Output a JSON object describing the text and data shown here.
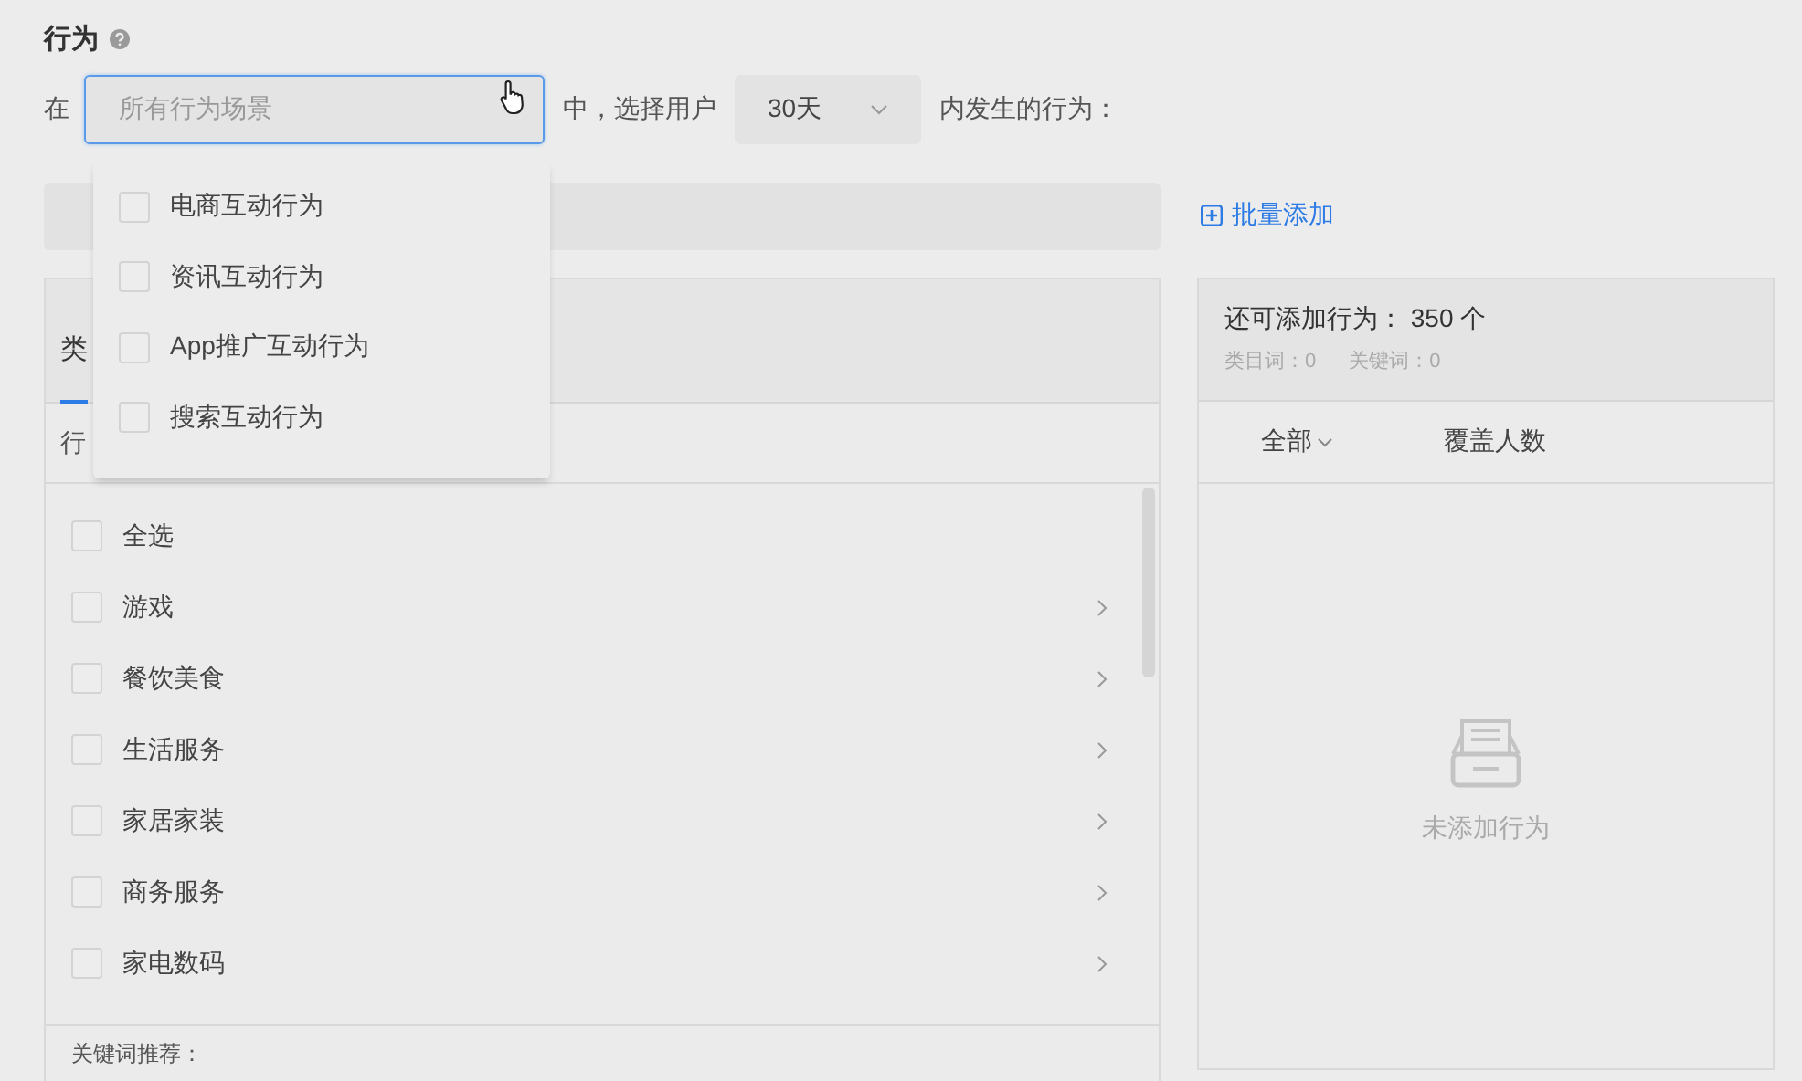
{
  "title": "行为",
  "filter": {
    "prefix": "在",
    "scene_select": {
      "placeholder": "所有行为场景",
      "focused": true
    },
    "middle": "中，选择用户",
    "period_select": {
      "value": "30天"
    },
    "suffix": "内发生的行为："
  },
  "scene_dropdown": {
    "options": [
      {
        "label": "电商互动行为",
        "checked": false
      },
      {
        "label": "资讯互动行为",
        "checked": false
      },
      {
        "label": "App推广互动行为",
        "checked": false
      },
      {
        "label": "搜索互动行为",
        "checked": false
      }
    ]
  },
  "batch_add": "批量添加",
  "left_panel": {
    "tabs": [
      {
        "label": "类",
        "selected": true
      }
    ],
    "column_1": "行",
    "items": [
      {
        "label": "全选",
        "kind": "all",
        "checked": false
      },
      {
        "label": "游戏",
        "kind": "category",
        "checked": false
      },
      {
        "label": "餐饮美食",
        "kind": "category",
        "checked": false
      },
      {
        "label": "生活服务",
        "kind": "category",
        "checked": false
      },
      {
        "label": "家居家装",
        "kind": "category",
        "checked": false
      },
      {
        "label": "商务服务",
        "kind": "category",
        "checked": false
      },
      {
        "label": "家电数码",
        "kind": "category",
        "checked": false
      }
    ],
    "footer": "关键词推荐："
  },
  "right_panel": {
    "remaining": "还可添加行为： 350 个",
    "category_count": "类目词：0",
    "keyword_count": "关键词：0",
    "columns": [
      "全部",
      "覆盖人数"
    ],
    "empty_text": "未添加行为"
  }
}
